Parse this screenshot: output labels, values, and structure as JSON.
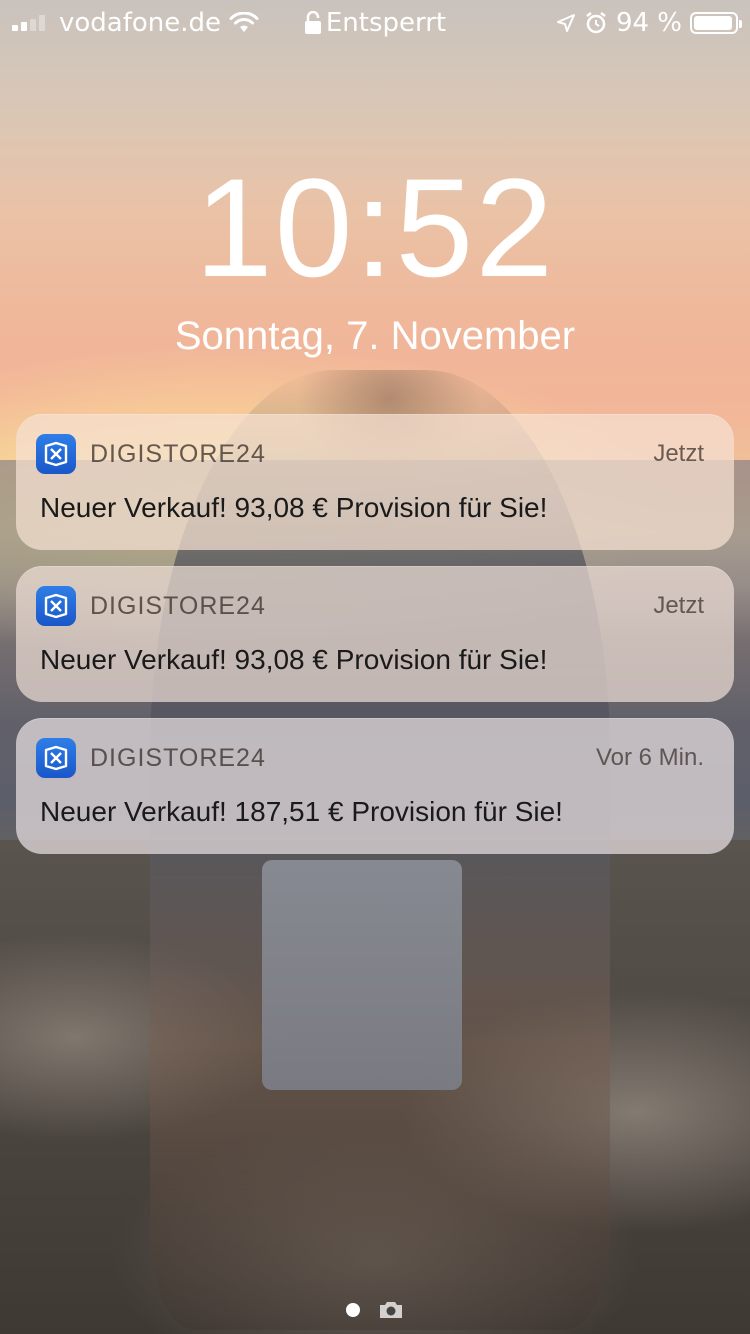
{
  "status_bar": {
    "carrier": "vodafone.de",
    "lock_status": "Entsperrt",
    "battery_percent": "94 %",
    "battery_level": 0.94,
    "signal_bars_active": 2,
    "signal_bars_total": 4
  },
  "lock_screen": {
    "time": "10:52",
    "date": "Sonntag, 7. November"
  },
  "notifications": [
    {
      "app": "DIGISTORE24",
      "time": "Jetzt",
      "message": "Neuer Verkauf! 93,08 € Provision für Sie!"
    },
    {
      "app": "DIGISTORE24",
      "time": "Jetzt",
      "message": "Neuer Verkauf! 93,08 € Provision für Sie!"
    },
    {
      "app": "DIGISTORE24",
      "time": "Vor 6 Min.",
      "message": "Neuer Verkauf! 187,51 € Provision für Sie!"
    }
  ],
  "colors": {
    "app_icon": "#1a57c9"
  }
}
